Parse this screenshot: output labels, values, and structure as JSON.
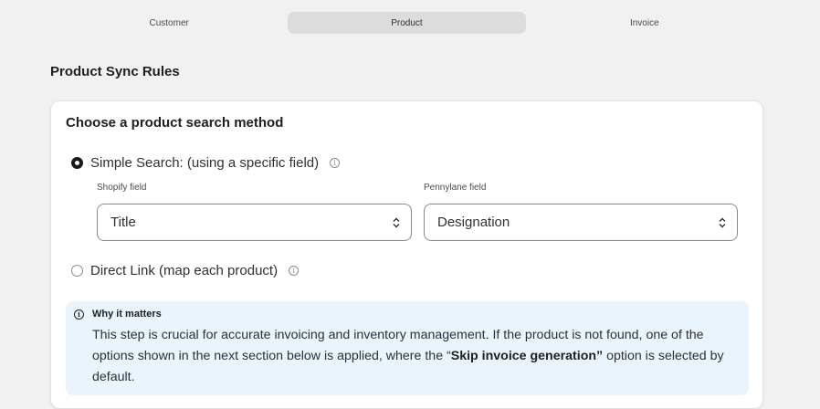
{
  "tabs": [
    {
      "label": "Customer",
      "active": false
    },
    {
      "label": "Product",
      "active": true
    },
    {
      "label": "Invoice",
      "active": false
    }
  ],
  "section_title": "Product Sync Rules",
  "card": {
    "title": "Choose a product search method",
    "option_simple": {
      "label": "Simple Search: (using a specific field)",
      "selected": true
    },
    "shopify_field": {
      "label": "Shopify field",
      "value": "Title"
    },
    "pennylane_field": {
      "label": "Pennylane field",
      "value": "Designation"
    },
    "option_direct": {
      "label": "Direct Link (map each product)",
      "selected": false
    }
  },
  "banner": {
    "title": "Why it matters",
    "text_before": "This step is crucial for accurate invoicing and inventory management. If the product is not found, one of the options shown in the next section below is applied, where the “",
    "text_bold": "Skip invoice generation”",
    "text_after": " option is selected by default."
  },
  "icons": {
    "info": "info-icon",
    "chevron": "select-chevron-icon"
  },
  "colors": {
    "page_bg": "#f1f1f1",
    "banner_bg": "#eaf4fc",
    "active_tab_bg": "#dcdcdc"
  }
}
